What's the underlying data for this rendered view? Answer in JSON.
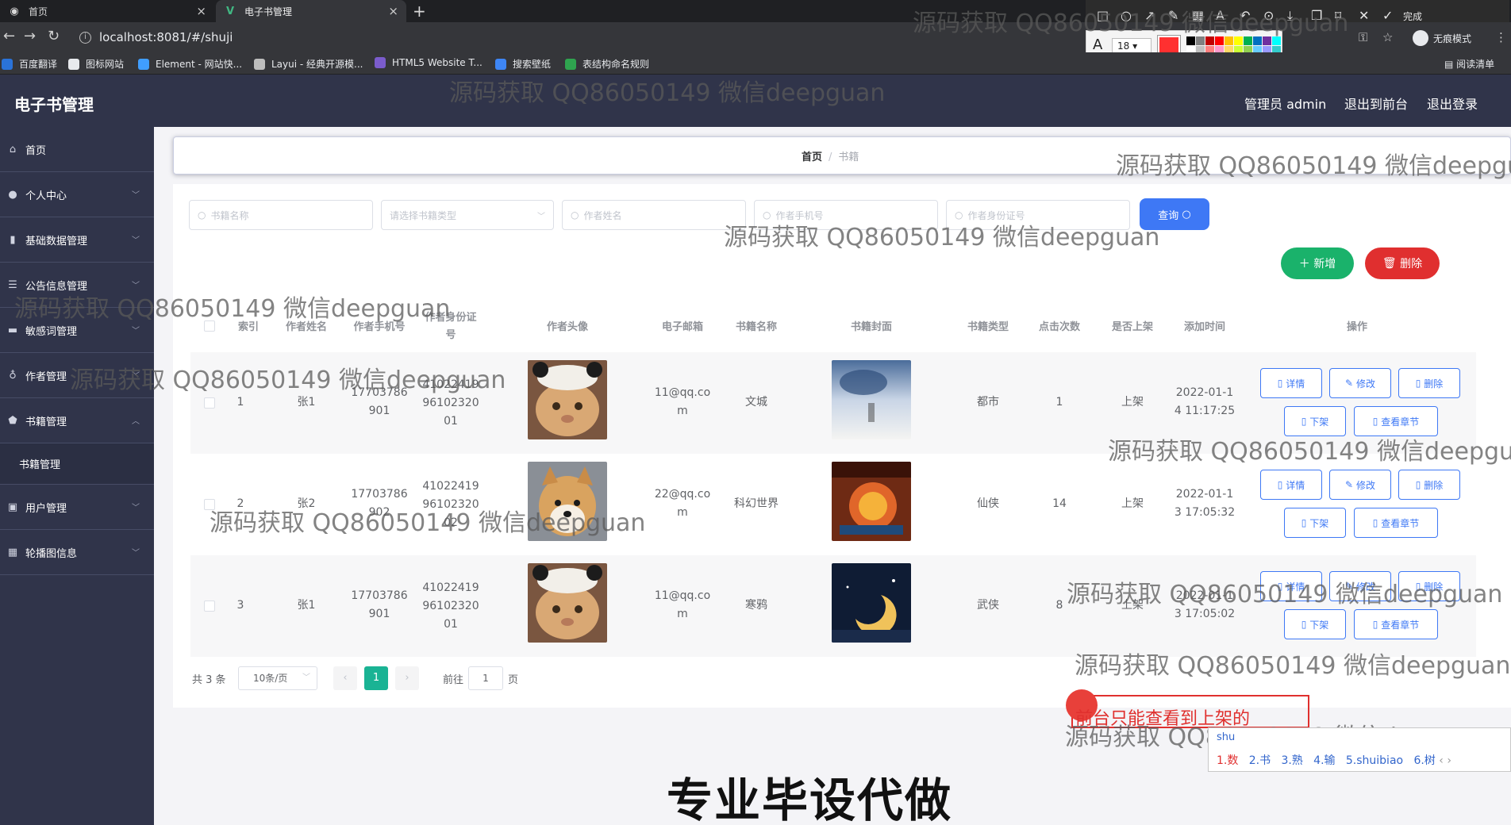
{
  "browser": {
    "tabs": [
      {
        "label": "首页",
        "icon": "gear-circle-icon"
      },
      {
        "label": "电子书管理",
        "icon": "vue-logo-icon"
      }
    ],
    "url": "localhost:8081/#/shuji",
    "bookmarks": [
      {
        "label": "百度翻译",
        "color": "#2a73d9"
      },
      {
        "label": "图标网站",
        "color": "#222222"
      },
      {
        "label": "Element - 网站快...",
        "color": "#409eff"
      },
      {
        "label": "Layui - 经典开源模...",
        "color": "#555555"
      },
      {
        "label": "HTML5 Website T...",
        "color": "#7b5ccc"
      },
      {
        "label": "搜索壁纸",
        "color": "#3e86f5"
      },
      {
        "label": "表结构命名规则",
        "color": "#2fa44f"
      }
    ],
    "incognito_label": "无痕模式",
    "reading_list_label": "阅读清单",
    "annotation_font_size": "18",
    "annotation_colors": [
      "#000000",
      "#7f7f7f",
      "#c00000",
      "#ff0000",
      "#ffc000",
      "#ffff00",
      "#00b050",
      "#0070c0",
      "#7030a0",
      "#00ffff",
      "#ffffff",
      "#bfbfbf",
      "#ff7f7f",
      "#ff99cc",
      "#ffd966",
      "#ccff33",
      "#92d050",
      "#66ccff",
      "#9999ff",
      "#33cccc"
    ]
  },
  "header": {
    "title": "电子书管理",
    "admin": "管理员 admin",
    "to_front": "退出到前台",
    "logout": "退出登录"
  },
  "sidebar": {
    "items": [
      {
        "label": "首页",
        "icon": "home-icon"
      },
      {
        "label": "个人中心",
        "icon": "user-icon"
      },
      {
        "label": "基础数据管理",
        "icon": "bar-chart-icon"
      },
      {
        "label": "公告信息管理",
        "icon": "list-icon"
      },
      {
        "label": "敏感词管理",
        "icon": "ticket-icon"
      },
      {
        "label": "作者管理",
        "icon": "mic-icon"
      },
      {
        "label": "书籍管理",
        "icon": "shield-icon"
      },
      {
        "label": "书籍管理",
        "icon": "none"
      },
      {
        "label": "用户管理",
        "icon": "briefcase-icon"
      },
      {
        "label": "轮播图信息",
        "icon": "grid-icon"
      }
    ]
  },
  "breadcrumb": {
    "home": "首页",
    "current": "书籍"
  },
  "search": {
    "book_name_placeholder": "书籍名称",
    "book_type_placeholder": "请选择书籍类型",
    "author_name_placeholder": "作者姓名",
    "author_phone_placeholder": "作者手机号",
    "author_id_placeholder": "作者身份证号",
    "query_label": "查询"
  },
  "actions": {
    "add_label": "新增",
    "delete_label": "删除"
  },
  "table": {
    "columns": [
      "索引",
      "作者姓名",
      "作者手机号",
      "作者身份证号",
      "作者头像",
      "电子邮箱",
      "书籍名称",
      "书籍封面",
      "书籍类型",
      "点击次数",
      "是否上架",
      "添加时间",
      "操作"
    ],
    "rows": [
      {
        "index": "1",
        "author": "张1",
        "phone": [
          "17703786",
          "901"
        ],
        "id_card": [
          "41022419",
          "96102320",
          "01"
        ],
        "email": [
          "11@qq.co",
          "m"
        ],
        "book": "文城",
        "type": "都市",
        "clicks": "1",
        "on_shelf": "上架",
        "time": [
          "2022-01-1",
          "4 11:17:25"
        ]
      },
      {
        "index": "2",
        "author": "张2",
        "phone": [
          "17703786",
          "902"
        ],
        "id_card": [
          "41022419",
          "96102320",
          "02"
        ],
        "email": [
          "22@qq.co",
          "m"
        ],
        "book": "科幻世界",
        "type": "仙侠",
        "clicks": "14",
        "on_shelf": "上架",
        "time": [
          "2022-01-1",
          "3 17:05:32"
        ]
      },
      {
        "index": "3",
        "author": "张1",
        "phone": [
          "17703786",
          "901"
        ],
        "id_card": [
          "41022419",
          "96102320",
          "01"
        ],
        "email": [
          "11@qq.co",
          "m"
        ],
        "book": "寒鸦",
        "type": "武侠",
        "clicks": "8",
        "on_shelf": "上架",
        "time": [
          "2022-01-1",
          "3 17:05:02"
        ]
      }
    ],
    "row_actions": {
      "detail": "详情",
      "edit": "修改",
      "delete": "删除",
      "off_shelf": "下架",
      "chapters": "查看章节"
    }
  },
  "pagination": {
    "total": "共 3 条",
    "page_size": "10条/页",
    "current": "1",
    "goto": "前往",
    "goto_value": "1",
    "page_unit": "页"
  },
  "overlay": {
    "watermark": "源码获取 QQ86050149 微信deepguan",
    "annotation": "前台只能查看到上架的",
    "ime_pinyin": "shu",
    "ime_candidates": [
      "1.数",
      "2.书",
      "3.熟",
      "4.输",
      "5.shuibiao",
      "6.树"
    ],
    "banner": "专业毕设代做"
  }
}
